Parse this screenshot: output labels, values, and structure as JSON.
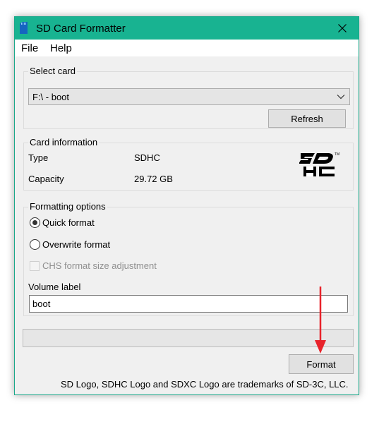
{
  "window": {
    "title": "SD Card Formatter",
    "accent_color": "#18b391",
    "title_icon": "sd-card-icon",
    "close_icon": "close-icon"
  },
  "menu": {
    "file": "File",
    "help": "Help"
  },
  "select_card": {
    "group_label": "Select card",
    "selected": "F:\\ - boot",
    "dropdown_icon": "chevron-down-icon",
    "refresh_label": "Refresh"
  },
  "card_info": {
    "group_label": "Card information",
    "type_label": "Type",
    "type_value": "SDHC",
    "capacity_label": "Capacity",
    "capacity_value": "29.72 GB",
    "logo": "sdhc-logo"
  },
  "formatting": {
    "group_label": "Formatting options",
    "quick_label": "Quick format",
    "quick_selected": true,
    "overwrite_label": "Overwrite format",
    "overwrite_selected": false,
    "chs_label": "CHS format size adjustment",
    "chs_enabled": false,
    "volume_label_caption": "Volume label",
    "volume_label_value": "boot"
  },
  "progress": {
    "value": 0
  },
  "actions": {
    "format_label": "Format",
    "annotation_arrow_color": "#e8232b"
  },
  "footer": {
    "note": "SD Logo, SDHC Logo and SDXC Logo are trademarks of SD-3C, LLC."
  }
}
